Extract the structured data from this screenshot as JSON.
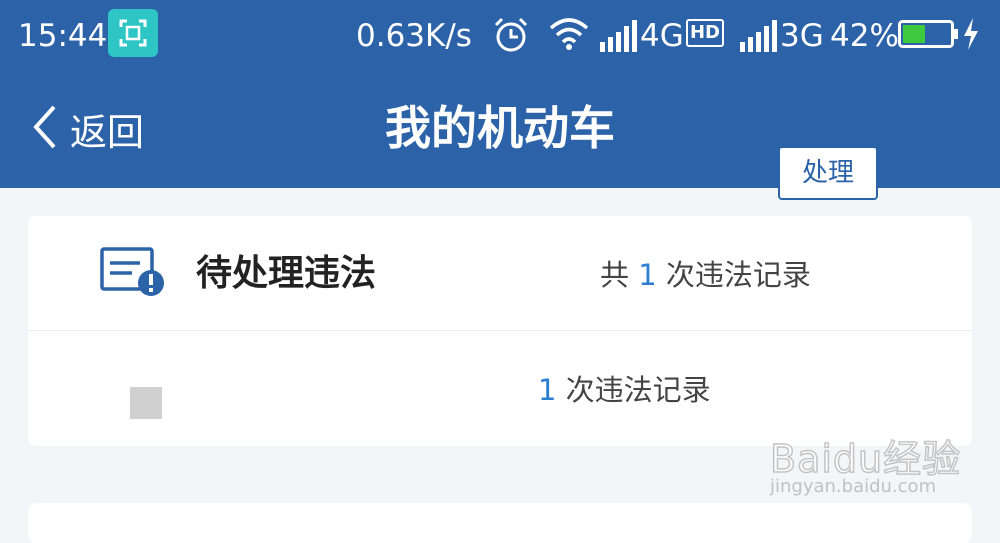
{
  "status_bar": {
    "time": "15:44",
    "speed": "0.63K/s",
    "net1": "4G",
    "hd": "HD",
    "net2": "3G",
    "battery": "42%",
    "icons": [
      "scan-icon",
      "alarm-clock-icon",
      "wifi-icon",
      "signal-icon",
      "hd-icon",
      "battery-icon",
      "charging-icon"
    ]
  },
  "nav": {
    "back_label": "返回",
    "title": "我的机动车"
  },
  "violations": {
    "header_title": "待处理违法",
    "summary_prefix": "共",
    "summary_count": "1",
    "summary_suffix": "次违法记录",
    "vehicle": {
      "count": "1",
      "count_suffix": "次违法记录",
      "action_label": "处理"
    }
  },
  "watermark": {
    "main": "Baidu经验",
    "sub": "jingyan.baidu.com"
  },
  "colors": {
    "header": "#2b62a8",
    "accent": "#2b7fd0",
    "scan_badge": "#2ec5c5",
    "background": "#f3f6f8"
  }
}
